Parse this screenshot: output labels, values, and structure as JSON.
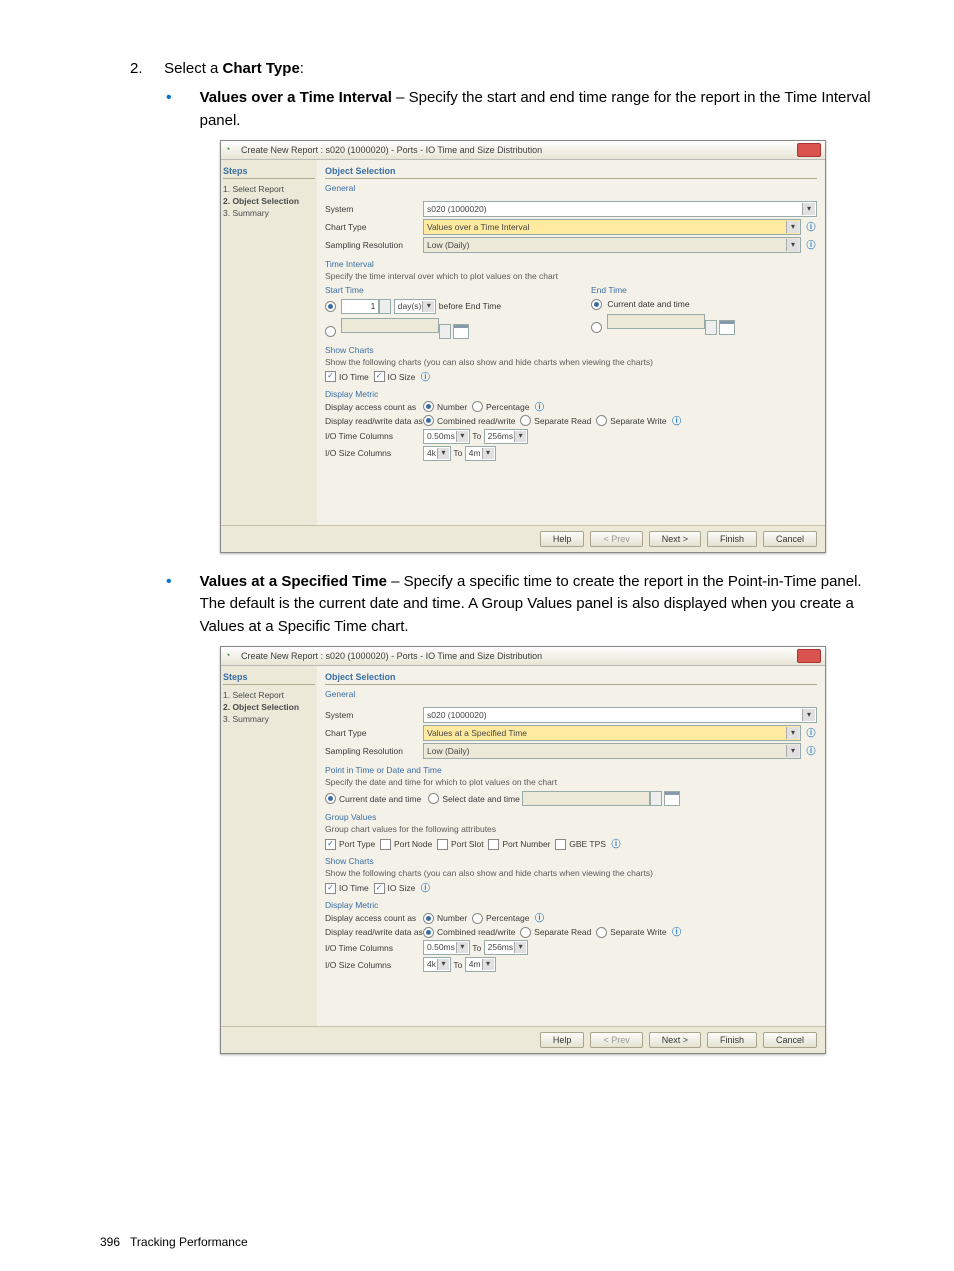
{
  "step": {
    "num": "2.",
    "text_pre": "Select a ",
    "text_bold": "Chart Type",
    "text_post": ":"
  },
  "bullet1": {
    "title": "Values over a Time Interval",
    "desc": " – Specify the start and end time range for the report in the Time Interval panel."
  },
  "bullet2": {
    "title": "Values at a Specified Time",
    "desc": " – Specify a specific time to create the report in the Point-in-Time panel. The default is the current date and time. A Group Values panel is also displayed when you create a Values at a Specific Time chart."
  },
  "dlg": {
    "title": "Create New Report : s020 (1000020) - Ports - IO Time and Size Distribution",
    "steps_hdr": "Steps",
    "obj_sel_hdr": "Object Selection",
    "step1": "1. Select Report",
    "step2": "2. Object Selection",
    "step3": "3. Summary",
    "gen": "General",
    "system_lbl": "System",
    "system_val": "s020 (1000020)",
    "chart_type_lbl": "Chart Type",
    "chart_type_val1": "Values over a Time Interval",
    "chart_type_val2": "Values at a Specified Time",
    "samp_lbl": "Sampling Resolution",
    "samp_val": "Low (Daily)",
    "ti_title": "Time Interval",
    "ti_desc": "Specify the time interval over which to plot values on the chart",
    "start_time": "Start Time",
    "end_time": "End Time",
    "before_end": "before End Time",
    "current_dt": "Current date and time",
    "rel_value": "1",
    "rel_unit": "day(s)",
    "pit_title": "Point in Time or Date and Time",
    "pit_desc": "Specify the date and time for which to plot values on the chart",
    "pit_opt1": "Current date and time",
    "pit_opt2": "Select date and time",
    "gv_title": "Group Values",
    "gv_desc": "Group chart values for the following attributes",
    "gv_porttype": "Port Type",
    "gv_portnode": "Port Node",
    "gv_portslot": "Port Slot",
    "gv_portnum": "Port Number",
    "gv_gbetps": "GBE TPS",
    "sc_title": "Show Charts",
    "sc_desc": "Show the following charts (you can also show and hide charts when viewing the charts)",
    "sc_iotime": "IO Time",
    "sc_iosize": "IO Size",
    "dm_title": "Display Metric",
    "dm_access_lbl": "Display access count as",
    "dm_number": "Number",
    "dm_pct": "Percentage",
    "dm_rw_lbl": "Display read/write data as",
    "dm_rw_comb": "Combined read/write",
    "dm_rw_sr": "Separate Read",
    "dm_rw_sw": "Separate Write",
    "dm_iotc_lbl": "I/O Time Columns",
    "dm_iotc_from": "0.50ms",
    "dm_iotc_to": "256ms",
    "dm_iosc_lbl": "I/O Size Columns",
    "dm_iosc_from": "4k",
    "dm_iosc_to": "4m",
    "to": "To",
    "help": "Help",
    "prev": "< Prev",
    "next": "Next >",
    "finish": "Finish",
    "cancel": "Cancel"
  },
  "footer": {
    "pagenum": "396",
    "section": "Tracking Performance"
  }
}
